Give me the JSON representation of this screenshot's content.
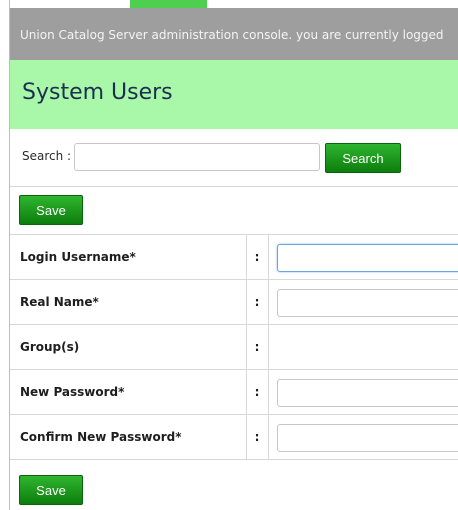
{
  "header": {
    "notice": "Union Catalog Server administration console. you are currently logged"
  },
  "page": {
    "title": "System Users"
  },
  "search": {
    "label": "Search :",
    "value": "",
    "placeholder": "",
    "button_label": "Search"
  },
  "actions": {
    "save_top_label": "Save",
    "save_bottom_label": "Save"
  },
  "form": {
    "rows": [
      {
        "label": "Login Username*",
        "separator": ":",
        "value": ""
      },
      {
        "label": "Real Name*",
        "separator": ":",
        "value": ""
      },
      {
        "label": "Group(s)",
        "separator": ":"
      },
      {
        "label": "New Password*",
        "separator": ":",
        "value": ""
      },
      {
        "label": "Confirm New Password*",
        "separator": ":",
        "value": ""
      }
    ]
  },
  "colors": {
    "top_bar": "#9e9e9e",
    "title_bar": "#a9f7a9",
    "accent_green": "#0d7d0d",
    "focus_blue": "#6aa4e3"
  }
}
